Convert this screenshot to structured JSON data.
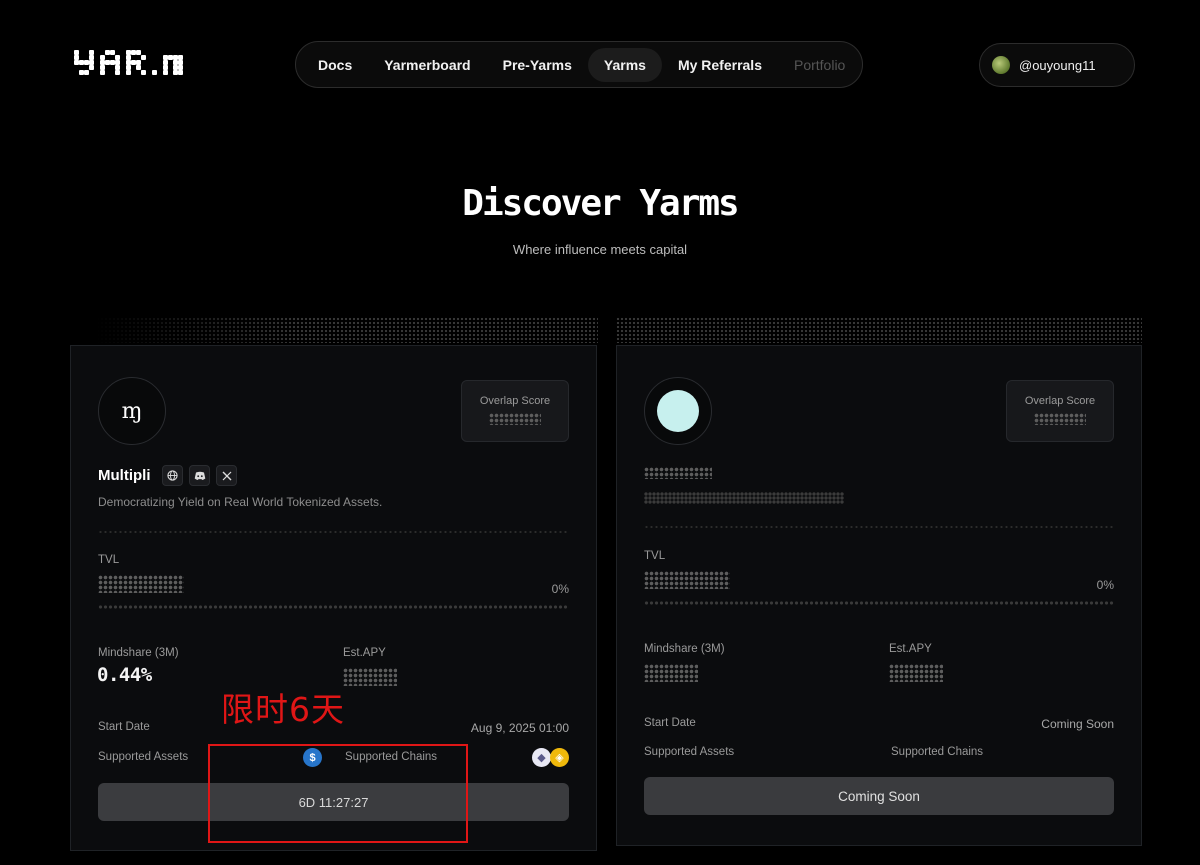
{
  "header": {
    "nav": [
      {
        "label": "Docs",
        "state": "normal"
      },
      {
        "label": "Yarmerboard",
        "state": "normal"
      },
      {
        "label": "Pre-Yarms",
        "state": "normal"
      },
      {
        "label": "Yarms",
        "state": "active"
      },
      {
        "label": "My Referrals",
        "state": "normal"
      },
      {
        "label": "Portfolio",
        "state": "disabled"
      }
    ],
    "user": {
      "handle": "@ouyoung11"
    }
  },
  "hero": {
    "title": "Discover Yarms",
    "subtitle": "Where influence meets capital"
  },
  "cards": [
    {
      "name": "Multipli",
      "logo_mark": "ɱ",
      "description": "Democratizing Yield on Real World Tokenized Assets.",
      "overlap_label": "Overlap Score",
      "tvl_label": "TVL",
      "tvl_pct": "0%",
      "mindshare_label": "Mindshare (3M)",
      "mindshare_value": "0.44%",
      "apy_label": "Est.APY",
      "start_label": "Start Date",
      "start_value": "Aug 9, 2025 01:00",
      "assets_label": "Supported Assets",
      "chains_label": "Supported Chains",
      "button_label": "6D 11:27:27",
      "socials": [
        "globe-icon",
        "discord-icon",
        "x-icon"
      ],
      "assets": [
        "usdc-icon"
      ],
      "chains": [
        "ethereum-icon",
        "bnb-icon"
      ]
    },
    {
      "overlap_label": "Overlap Score",
      "tvl_label": "TVL",
      "tvl_pct": "0%",
      "mindshare_label": "Mindshare (3M)",
      "apy_label": "Est.APY",
      "start_label": "Start Date",
      "start_value": "Coming Soon",
      "assets_label": "Supported Assets",
      "chains_label": "Supported Chains",
      "button_label": "Coming Soon",
      "logo_color": "#c7f0ee"
    }
  ],
  "annotation": {
    "text": "限时6天",
    "color": "#e01616"
  },
  "colors": {
    "background": "#000000",
    "card": "#0b0c0e",
    "button": "#3b3c3f"
  }
}
